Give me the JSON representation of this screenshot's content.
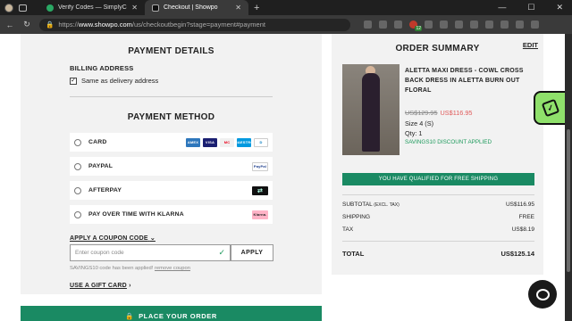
{
  "browser": {
    "tabs": [
      {
        "title": "Verify Codes — SimplyCodes",
        "active": false
      },
      {
        "title": "Checkout | Showpo",
        "active": true
      }
    ],
    "url_prefix": "https://",
    "url_host": "www.showpo.com",
    "url_path": "/us/checkoutbegin?stage=payment#payment",
    "extension_badge": "12"
  },
  "payment": {
    "title": "PAYMENT DETAILS",
    "billing_label": "BILLING ADDRESS",
    "same_as_delivery": "Same as delivery address",
    "method_title": "PAYMENT METHOD",
    "methods": [
      {
        "label": "CARD"
      },
      {
        "label": "PAYPAL"
      },
      {
        "label": "AFTERPAY"
      },
      {
        "label": "PAY OVER TIME WITH KLARNA"
      }
    ],
    "logos": {
      "amex": "AMEX",
      "visa": "VISA",
      "mc": "MC",
      "maestro": "MAESTRO",
      "diners": "D",
      "paypal": "PayPal",
      "afterpay": "⇄",
      "klarna": "Klarna."
    },
    "coupon_link": "APPLY A COUPON CODE",
    "coupon_placeholder": "Enter coupon code",
    "apply_label": "APPLY",
    "applied_msg": "SAVINGS10 code has been applied!",
    "remove_coupon": "remove coupon",
    "gift_card": "USE A GIFT CARD",
    "place_order": "PLACE YOUR ORDER"
  },
  "summary": {
    "title": "ORDER SUMMARY",
    "edit": "EDIT",
    "product_name": "ALETTA MAXI DRESS - COWL CROSS BACK DRESS IN ALETTA BURN OUT FLORAL",
    "price_old": "US$129.95",
    "price_new": "US$116.95",
    "size": "Size 4 (S)",
    "qty": "Qty: 1",
    "discount_note": "SAVINGS10 DISCOUNT APPLIED",
    "shipping_banner": "YOU HAVE QUALIFIED FOR FREE SHIPPING",
    "subtotal_label": "SUBTOTAL",
    "subtotal_note": "(EXCL. TAX)",
    "subtotal_value": "US$116.95",
    "shipping_label": "SHIPPING",
    "shipping_value": "FREE",
    "tax_label": "TAX",
    "tax_value": "US$8.19",
    "total_label": "TOTAL",
    "total_value": "US$125.14"
  }
}
